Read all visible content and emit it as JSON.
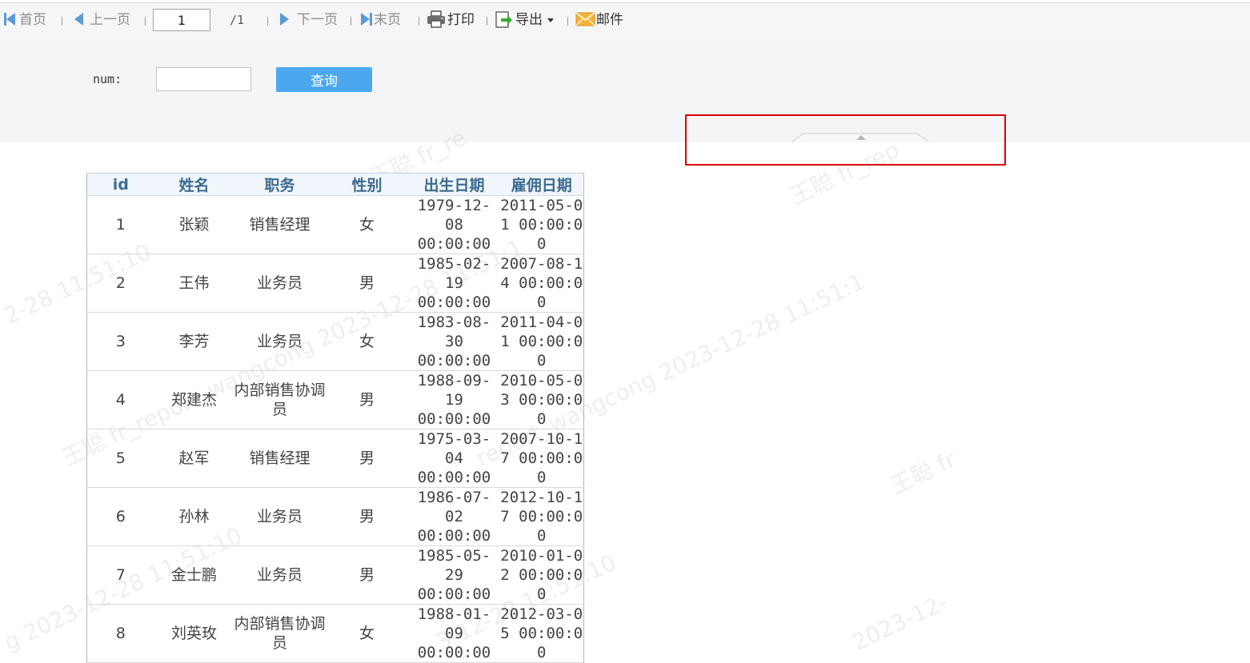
{
  "toolbar": {
    "first": "首页",
    "prev": "上一页",
    "page_value": "1",
    "page_total": "/1",
    "next": "下一页",
    "last": "末页",
    "print": "打印",
    "export": "导出",
    "mail": "邮件"
  },
  "params": {
    "num_label": "num:",
    "query_label": "查询"
  },
  "watermark": {
    "w1": "王聪 fr_re",
    "w2": "王聪 fr_rep",
    "w3": "2-28 11:51:10",
    "w4": "王聪 fr_report_wangcong 2023-12-28 11:51:1",
    "w5": "report_wangcong 2023-12-28 11:51:1",
    "w6": "王聪 fr",
    "w7": "g 2023-12-28 11:51:10",
    "w8": "3-12-28 11:51:10",
    "w9": "2023-12-"
  },
  "table": {
    "headers": [
      "id",
      "姓名",
      "职务",
      "性别",
      "出生日期",
      "雇佣日期"
    ],
    "rows": [
      {
        "id": "1",
        "name": "张颖",
        "title": "销售经理",
        "gender": "女",
        "birth": "1979-12-08 00:00:00",
        "hire": "2011-05-01 00:00:00"
      },
      {
        "id": "2",
        "name": "王伟",
        "title": "业务员",
        "gender": "男",
        "birth": "1985-02-19 00:00:00",
        "hire": "2007-08-14 00:00:00"
      },
      {
        "id": "3",
        "name": "李芳",
        "title": "业务员",
        "gender": "女",
        "birth": "1983-08-30 00:00:00",
        "hire": "2011-04-01 00:00:00"
      },
      {
        "id": "4",
        "name": "郑建杰",
        "title": "内部销售协调员",
        "gender": "男",
        "birth": "1988-09-19 00:00:00",
        "hire": "2010-05-03 00:00:00"
      },
      {
        "id": "5",
        "name": "赵军",
        "title": "销售经理",
        "gender": "男",
        "birth": "1975-03-04 00:00:00",
        "hire": "2007-10-17 00:00:00"
      },
      {
        "id": "6",
        "name": "孙林",
        "title": "业务员",
        "gender": "男",
        "birth": "1986-07-02 00:00:00",
        "hire": "2012-10-17 00:00:00"
      },
      {
        "id": "7",
        "name": "金士鹏",
        "title": "业务员",
        "gender": "男",
        "birth": "1985-05-29 00:00:00",
        "hire": "2010-01-02 00:00:00"
      },
      {
        "id": "8",
        "name": "刘英玫",
        "title": "内部销售协调员",
        "gender": "女",
        "birth": "1988-01-09 00:00:00",
        "hire": "2012-03-05 00:00:00"
      }
    ]
  },
  "colors": {
    "accent": "#4ba8ee",
    "nav_arrow": "#5b9bd5",
    "highlight": "#e00000"
  }
}
